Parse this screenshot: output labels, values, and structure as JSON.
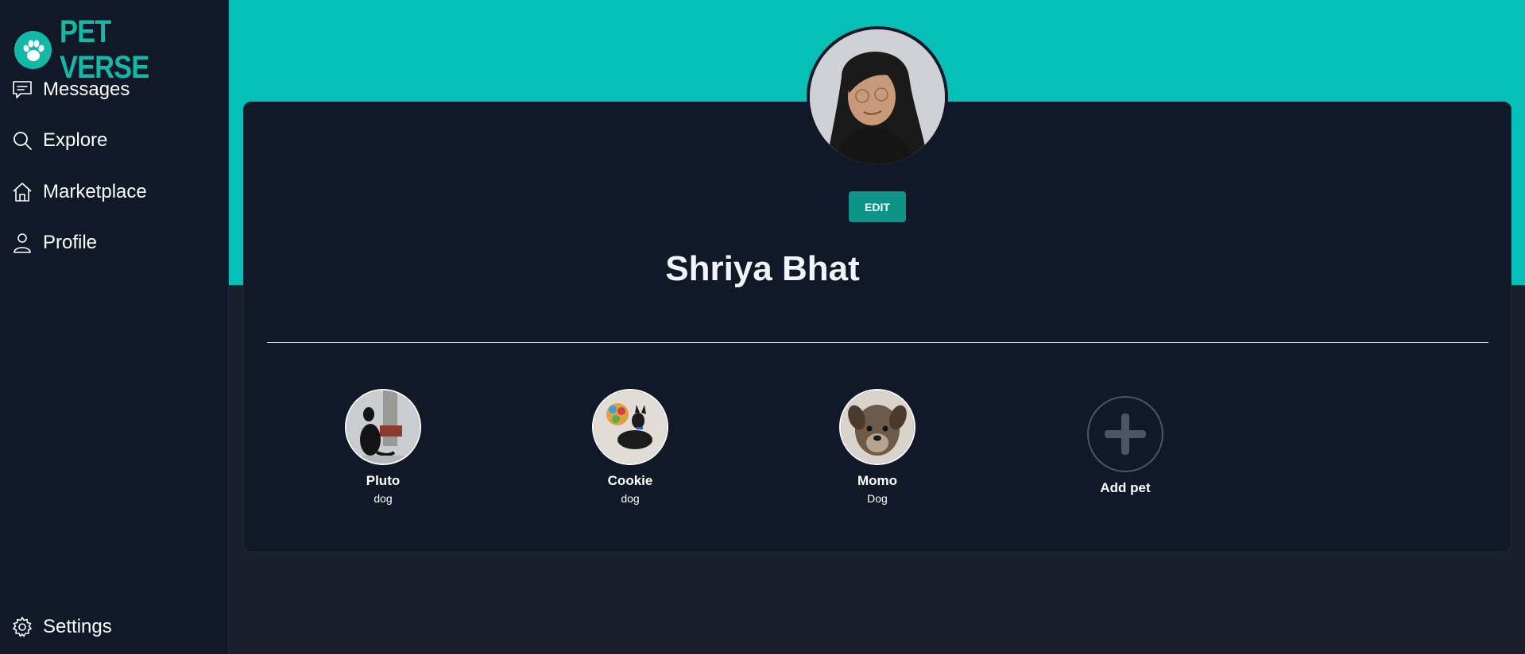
{
  "brand": {
    "name": "PET VERSE",
    "color": "#14b8a6"
  },
  "nav": {
    "messages": {
      "label": "Messages",
      "icon": "chat-icon"
    },
    "explore": {
      "label": "Explore",
      "icon": "search-icon"
    },
    "marketplace": {
      "label": "Marketplace",
      "icon": "home-icon"
    },
    "profile": {
      "label": "Profile",
      "icon": "user-icon"
    },
    "settings": {
      "label": "Settings",
      "icon": "gear-icon"
    }
  },
  "profile": {
    "edit_label": "EDIT",
    "name": "Shriya Bhat"
  },
  "pets": [
    {
      "name": "Pluto",
      "type": "dog"
    },
    {
      "name": "Cookie",
      "type": "dog"
    },
    {
      "name": "Momo",
      "type": "Dog"
    }
  ],
  "add_pet": {
    "label": "Add pet"
  },
  "colors": {
    "accent": "#06bfb6",
    "button": "#0d9488",
    "sidebar": "#111827",
    "background": "#1a1f2e"
  }
}
